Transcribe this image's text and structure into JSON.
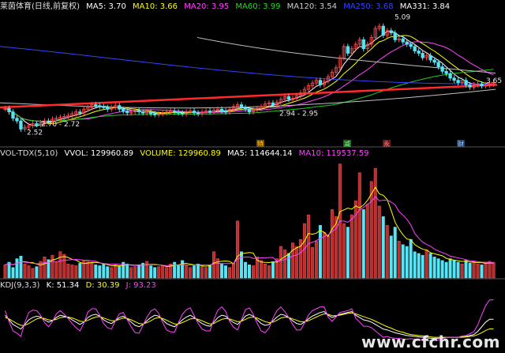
{
  "colors": {
    "up": "#ff4a4a",
    "down": "#57e5f5",
    "ma5": "#ffffff",
    "ma10": "#ffff00",
    "ma20": "#ff44ff",
    "ma60": "#22cc22",
    "ma120": "#c0c0c0",
    "ma250": "#3344ff",
    "ma331": "#ffffff",
    "trendline": "#ff2a2a",
    "volume_ma10": "#ff44ff"
  },
  "header": {
    "stock_name": "莱茵体育(日线,前复权)",
    "ma5": "MA5: 3.70",
    "ma10": "MA10: 3.66",
    "ma20": "MA20: 3.95",
    "ma60": "MA60: 3.99",
    "ma120": "MA120: 3.54",
    "ma250": "MA250: 3.68",
    "ma331": "MA331: 3.84"
  },
  "volume_header": {
    "name": "VOL-TDX(5,10)",
    "vvol": "VVOL: 129960.89",
    "volume": "VOLUME: 129960.89",
    "ma5": "MA5: 114644.14",
    "ma10": "MA10: 119537.59"
  },
  "kdj_header": {
    "name": "KDJ(9,3,3)",
    "k": "K: 51.34",
    "d": "D: 30.39",
    "j": "J: 93.23"
  },
  "annotations": {
    "high": "5.09",
    "low_left": "2.52",
    "range_left": "2.70 - 2.72",
    "range_mid": "2.94 - 2.95",
    "last_right": "3.65"
  },
  "markers": [
    "特",
    "减",
    "永",
    "财"
  ],
  "watermark": "www.cfchr.com",
  "chart_data": [
    {
      "type": "candlestick",
      "title": "莱茵体育(日线,前复权)",
      "ylim": [
        2.4,
        5.2
      ],
      "x": [
        1,
        2,
        3,
        4,
        5,
        6,
        7,
        8,
        9,
        10,
        11,
        12,
        13,
        14,
        15,
        16,
        17,
        18,
        19,
        20,
        21,
        22,
        23,
        24,
        25,
        26,
        27,
        28,
        29,
        30,
        31,
        32,
        33,
        34,
        35,
        36,
        37,
        38,
        39,
        40,
        41,
        42,
        43,
        44,
        45,
        46,
        47,
        48,
        49,
        50,
        51,
        52,
        53,
        54,
        55,
        56,
        57,
        58,
        59,
        60,
        61,
        62,
        63,
        64,
        65,
        66,
        67,
        68,
        69,
        70,
        71,
        72,
        73,
        74,
        75,
        76,
        77,
        78,
        79,
        80,
        81,
        82,
        83,
        84,
        85,
        86,
        87,
        88,
        89,
        90,
        91,
        92,
        93,
        94,
        95,
        96,
        97,
        98,
        99,
        100,
        101,
        102,
        103,
        104,
        105,
        106,
        107,
        108,
        109,
        110,
        111,
        112,
        113,
        114,
        115,
        116,
        117,
        118,
        119,
        120,
        121,
        122,
        123,
        124,
        125
      ],
      "close": [
        3.08,
        3.0,
        2.86,
        2.8,
        2.62,
        2.66,
        2.7,
        2.74,
        2.72,
        2.76,
        2.8,
        2.78,
        2.84,
        2.86,
        2.88,
        2.9,
        2.92,
        2.96,
        3.0,
        2.98,
        3.06,
        3.1,
        3.16,
        3.14,
        3.12,
        3.1,
        3.06,
        3.1,
        3.14,
        3.06,
        3.02,
        2.98,
        3.0,
        3.04,
        3.0,
        2.98,
        3.0,
        2.96,
        2.94,
        2.96,
        2.98,
        3.0,
        3.02,
        3.0,
        2.98,
        2.96,
        3.0,
        3.02,
        2.98,
        2.96,
        3.0,
        3.02,
        3.0,
        3.04,
        3.06,
        3.02,
        3.0,
        3.06,
        3.12,
        3.16,
        3.1,
        3.06,
        3.0,
        3.04,
        3.08,
        3.12,
        3.18,
        3.2,
        3.16,
        3.22,
        3.28,
        3.34,
        3.28,
        3.3,
        3.36,
        3.42,
        3.5,
        3.58,
        3.64,
        3.7,
        3.6,
        3.68,
        3.78,
        3.88,
        3.98,
        4.2,
        4.45,
        4.3,
        4.4,
        4.5,
        4.6,
        4.4,
        4.5,
        4.65,
        4.85,
        4.9,
        4.7,
        4.8,
        4.75,
        4.6,
        4.62,
        4.55,
        4.5,
        4.45,
        4.35,
        4.3,
        4.2,
        4.25,
        4.15,
        4.1,
        4.0,
        3.9,
        3.85,
        3.75,
        3.7,
        3.65,
        3.7,
        3.6,
        3.55,
        3.6,
        3.62,
        3.58,
        3.6,
        3.62,
        3.65
      ],
      "high_label": 5.09,
      "low_label": 2.52,
      "price_levels": [
        "2.70 - 2.72",
        "2.94 - 2.95",
        "3.65"
      ]
    },
    {
      "type": "bar",
      "title": "VOL-TDX(5,10)",
      "ylim": [
        0,
        135000
      ],
      "values": [
        15000,
        18000,
        12000,
        22000,
        25000,
        16000,
        14000,
        11000,
        13000,
        19000,
        24000,
        21000,
        26000,
        18000,
        30000,
        27000,
        16000,
        15000,
        14000,
        17000,
        20000,
        19000,
        18000,
        15000,
        14000,
        16000,
        13000,
        12000,
        15000,
        14000,
        18000,
        16000,
        12000,
        13000,
        15000,
        17000,
        19000,
        14000,
        12000,
        13000,
        14000,
        12000,
        16000,
        18000,
        15000,
        20000,
        14000,
        12000,
        14000,
        16000,
        13000,
        12000,
        15000,
        30000,
        22000,
        16000,
        14000,
        12000,
        17000,
        65000,
        30000,
        18000,
        15000,
        14000,
        24000,
        20000,
        16000,
        14000,
        18000,
        22000,
        36000,
        32000,
        28000,
        40000,
        36000,
        44000,
        62000,
        72000,
        35000,
        42000,
        60000,
        52000,
        48000,
        78000,
        70000,
        130000,
        62000,
        58000,
        72000,
        88000,
        120000,
        78000,
        84000,
        110000,
        125000,
        82000,
        70000,
        60000,
        48000,
        58000,
        42000,
        38000,
        36000,
        44000,
        30000,
        28000,
        26000,
        32000,
        28000,
        24000,
        22000,
        20000,
        18000,
        22000,
        20000,
        18000,
        16000,
        20000,
        17000,
        19000,
        16000,
        15000,
        17000,
        19000,
        18000
      ],
      "series": [
        {
          "name": "MA5",
          "values": [
            114644.14
          ]
        },
        {
          "name": "MA10",
          "values": [
            119537.59
          ]
        }
      ]
    },
    {
      "type": "line",
      "title": "KDJ(9,3,3)",
      "ylim": [
        -10,
        110
      ],
      "series": [
        {
          "name": "K",
          "values": [
            60,
            50,
            40,
            35,
            30,
            40,
            50,
            55,
            58,
            56,
            50,
            45,
            48,
            55,
            60,
            58,
            55,
            50,
            45,
            40,
            45,
            55,
            60,
            62,
            58,
            50,
            45,
            42,
            48,
            55,
            58,
            52,
            45,
            38,
            35,
            40,
            48,
            55,
            60,
            58,
            50,
            42,
            38,
            35,
            42,
            50,
            56,
            60,
            55,
            48,
            42,
            38,
            36,
            45,
            55,
            60,
            58,
            50,
            44,
            40,
            48,
            58,
            62,
            58,
            50,
            42,
            38,
            40,
            48,
            56,
            62,
            60,
            55,
            48,
            42,
            40,
            45,
            52,
            58,
            62,
            66,
            68,
            60,
            55,
            58,
            62,
            64,
            66,
            68,
            60,
            55,
            50,
            48,
            45,
            40,
            35,
            30,
            28,
            25,
            22,
            20,
            18,
            16,
            15,
            14,
            13,
            12,
            11,
            10,
            10,
            10,
            11,
            12,
            12,
            12,
            12,
            13,
            14,
            16,
            18,
            25,
            35,
            45,
            51.34,
            51.34
          ]
        },
        {
          "name": "D",
          "values": [
            55,
            52,
            47,
            42,
            38,
            38,
            42,
            47,
            52,
            54,
            53,
            50,
            49,
            51,
            55,
            56,
            56,
            54,
            51,
            47,
            46,
            49,
            53,
            56,
            57,
            54,
            51,
            48,
            48,
            51,
            54,
            53,
            50,
            46,
            42,
            41,
            44,
            48,
            53,
            55,
            53,
            49,
            45,
            41,
            41,
            44,
            48,
            52,
            53,
            51,
            48,
            44,
            41,
            42,
            47,
            51,
            53,
            52,
            49,
            46,
            47,
            51,
            55,
            56,
            54,
            50,
            46,
            44,
            45,
            49,
            54,
            56,
            55,
            52,
            49,
            46,
            46,
            48,
            52,
            56,
            60,
            63,
            62,
            59,
            59,
            60,
            62,
            64,
            65,
            63,
            60,
            57,
            54,
            51,
            47,
            43,
            39,
            35,
            32,
            28,
            25,
            23,
            20,
            18,
            17,
            16,
            15,
            14,
            13,
            12,
            12,
            12,
            12,
            12,
            12,
            12,
            12,
            13,
            14,
            15,
            18,
            22,
            27,
            30.39,
            30.39
          ]
        },
        {
          "name": "J",
          "values": [
            70,
            46,
            26,
            21,
            14,
            44,
            66,
            71,
            70,
            60,
            44,
            35,
            46,
            63,
            70,
            62,
            53,
            42,
            33,
            26,
            43,
            67,
            74,
            74,
            60,
            42,
            33,
            30,
            48,
            63,
            66,
            50,
            35,
            22,
            21,
            38,
            56,
            69,
            74,
            64,
            44,
            28,
            24,
            23,
            44,
            62,
            72,
            76,
            59,
            42,
            30,
            26,
            26,
            51,
            71,
            78,
            68,
            46,
            34,
            28,
            50,
            72,
            76,
            62,
            42,
            26,
            22,
            32,
            54,
            70,
            78,
            68,
            55,
            40,
            28,
            28,
            43,
            60,
            70,
            74,
            78,
            78,
            56,
            47,
            56,
            66,
            68,
            70,
            74,
            54,
            45,
            36,
            36,
            33,
            26,
            19,
            12,
            14,
            11,
            10,
            10,
            8,
            8,
            9,
            8,
            7,
            6,
            5,
            4,
            6,
            6,
            9,
            12,
            12,
            12,
            12,
            15,
            16,
            20,
            24,
            39,
            61,
            81,
            93.23,
            93.23
          ]
        }
      ]
    }
  ]
}
